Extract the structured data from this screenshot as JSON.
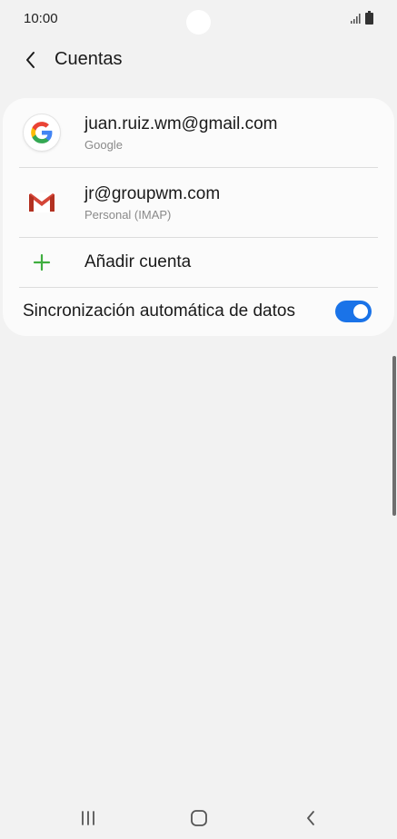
{
  "status_bar": {
    "time": "10:00",
    "signal_icon": "signal-icon",
    "battery_icon": "battery-icon"
  },
  "header": {
    "back_icon": "chevron-left-icon",
    "title": "Cuentas"
  },
  "accounts": [
    {
      "email": "juan.ruiz.wm@gmail.com",
      "type": "Google",
      "icon": "google-icon"
    },
    {
      "email": "jr@groupwm.com",
      "type": "Personal (IMAP)",
      "icon": "gmail-icon"
    }
  ],
  "add_account": {
    "label": "Añadir cuenta",
    "icon": "plus-icon",
    "icon_color": "#3fae3f"
  },
  "sync": {
    "label": "Sincronización automática de datos",
    "enabled": true,
    "toggle_color": "#1a73e8"
  },
  "nav_bar": {
    "recents_icon": "recents-icon",
    "home_icon": "home-icon",
    "back_icon": "back-icon"
  }
}
